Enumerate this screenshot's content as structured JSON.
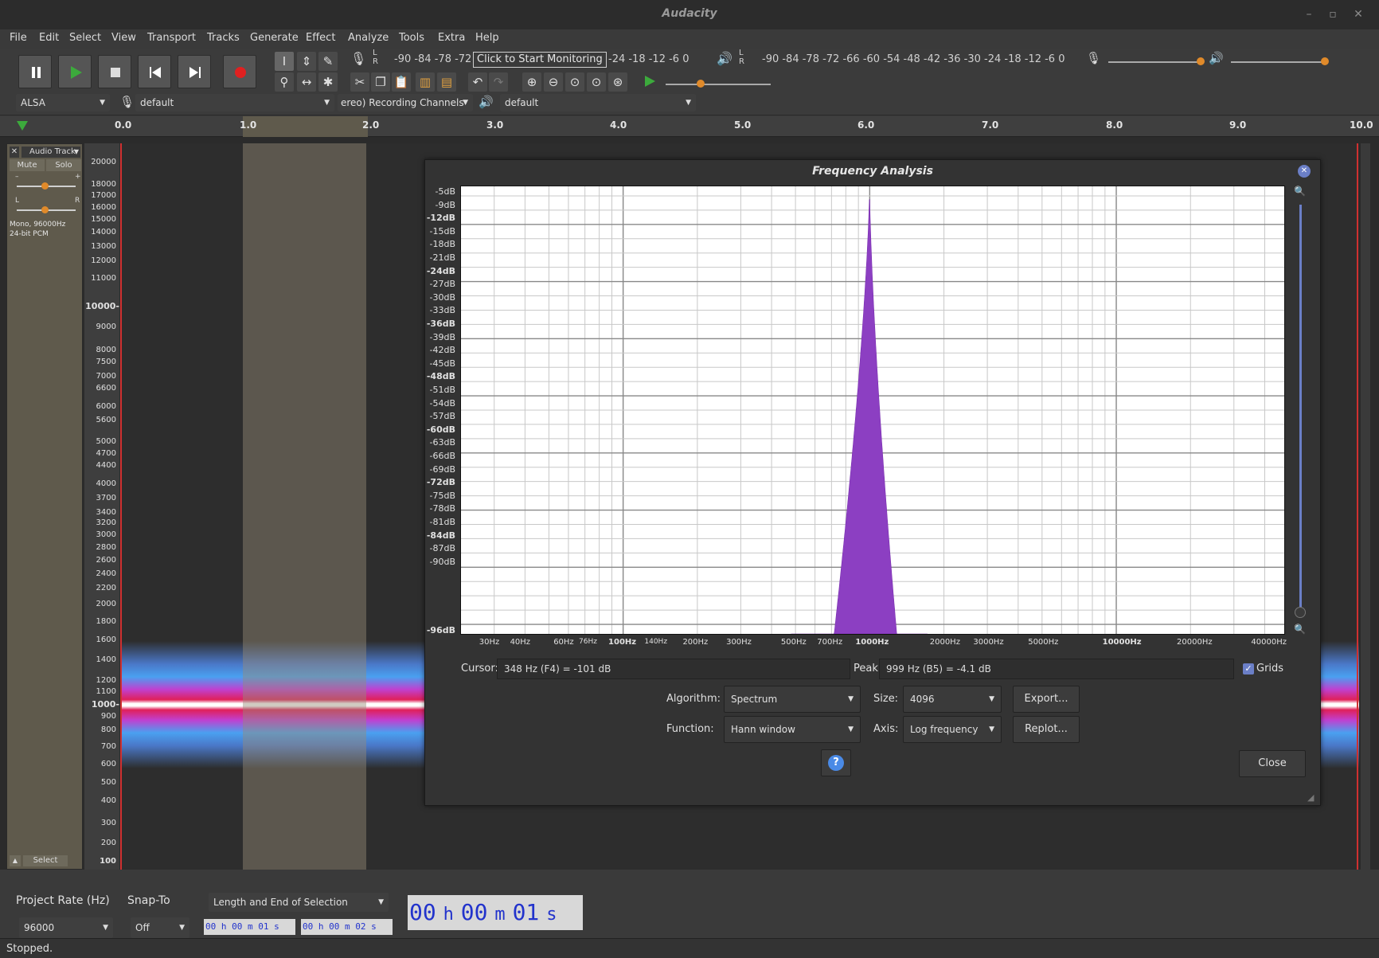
{
  "window": {
    "title": "Audacity"
  },
  "menu": [
    "File",
    "Edit",
    "Select",
    "View",
    "Transport",
    "Tracks",
    "Generate",
    "Effect",
    "Analyze",
    "Tools",
    "Extra",
    "Help"
  ],
  "meters": {
    "rec_left": "-90 -84 -78 -72",
    "monitor_button": "Click to Start Monitoring",
    "rec_right": "-24 -18 -12  -6   0",
    "play": "-90 -84 -78 -72 -66 -60 -54 -48 -42 -36 -30 -24 -18 -12  -6   0",
    "lr": "L\nR"
  },
  "device_bar": {
    "host": "ALSA",
    "rec_device": "default",
    "channels": "ereo) Recording Channels",
    "play_device": "default"
  },
  "ruler": [
    "0.0",
    "1.0",
    "2.0",
    "3.0",
    "4.0",
    "5.0",
    "6.0",
    "7.0",
    "8.0",
    "9.0",
    "10.0"
  ],
  "track": {
    "name": "Audio Track",
    "mute": "Mute",
    "solo": "Solo",
    "gain_minus": "–",
    "gain_plus": "+",
    "pan_l": "L",
    "pan_r": "R",
    "info1": "Mono, 96000Hz",
    "info2": "24-bit PCM",
    "select": "Select"
  },
  "vscale": [
    "20000",
    "18000",
    "17000",
    "16000",
    "15000",
    "14000",
    "13000",
    "12000",
    "11000",
    "10000-",
    "9000",
    "8000",
    "7500",
    "7000",
    "6600",
    "6000",
    "5600",
    "5000",
    "4700",
    "4400",
    "4000",
    "3700",
    "3400",
    "3200",
    "3000",
    "2800",
    "2600",
    "2400",
    "2200",
    "2000",
    "1800",
    "1600",
    "1400",
    "1200",
    "1100",
    "1000-",
    "900",
    "800",
    "700",
    "600",
    "500",
    "400",
    "300",
    "200",
    "100"
  ],
  "dialog": {
    "title": "Frequency Analysis",
    "db_labels": [
      "-5dB",
      "-9dB",
      "-12dB",
      "-15dB",
      "-18dB",
      "-21dB",
      "-24dB",
      "-27dB",
      "-30dB",
      "-33dB",
      "-36dB",
      "-39dB",
      "-42dB",
      "-45dB",
      "-48dB",
      "-51dB",
      "-54dB",
      "-57dB",
      "-60dB",
      "-63dB",
      "-66dB",
      "-69dB",
      "-72dB",
      "-75dB",
      "-78dB",
      "-81dB",
      "-84dB",
      "-87dB",
      "-90dB",
      "-96dB"
    ],
    "hz_labels": [
      "30Hz",
      "40Hz",
      "60Hz",
      "76Hz",
      "100Hz",
      "140Hz",
      "200Hz",
      "300Hz",
      "500Hz",
      "700Hz",
      "1000Hz",
      "2000Hz",
      "3000Hz",
      "5000Hz",
      "10000Hz",
      "20000Hz",
      "40000Hz"
    ],
    "cursor_label": "Cursor:",
    "cursor_value": "348 Hz (F4) = -101 dB",
    "peak_label": "Peak:",
    "peak_value": "999 Hz (B5) = -4.1 dB",
    "grids_label": "Grids",
    "algorithm_label": "Algorithm:",
    "algorithm_value": "Spectrum",
    "size_label": "Size:",
    "size_value": "4096",
    "export_button": "Export...",
    "function_label": "Function:",
    "function_value": "Hann window",
    "axis_label": "Axis:",
    "axis_value": "Log frequency",
    "replot_button": "Replot...",
    "help_button": "?",
    "close_button": "Close"
  },
  "bottom": {
    "project_rate_label": "Project Rate (Hz)",
    "snap_to_label": "Snap-To",
    "selection_mode": "Length and End of Selection",
    "project_rate": "96000",
    "snap_to": "Off",
    "sel_start": "00 h 00 m 01 s",
    "sel_end": "00 h 00 m 02 s",
    "time": {
      "h": "00",
      "hl": "h",
      "m": "00",
      "ml": "m",
      "s": "01",
      "sl": "s"
    }
  },
  "status": "Stopped.",
  "colors": {
    "spectrum_fill": "#8c3fc2",
    "record": "#e02020",
    "play": "#3caa3c"
  }
}
